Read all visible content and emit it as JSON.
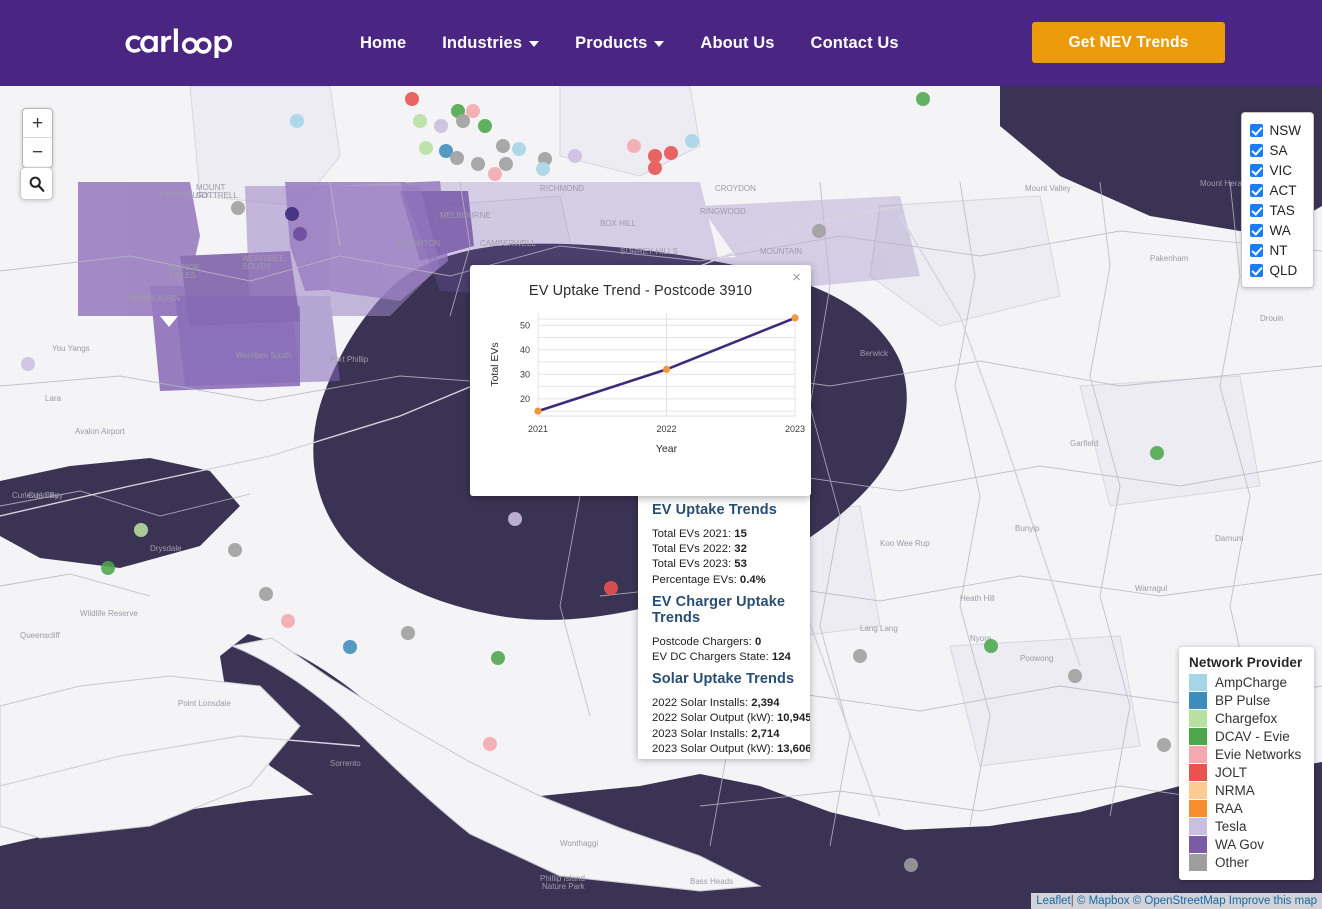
{
  "header": {
    "logo_text": "carloop",
    "nav": [
      {
        "label": "Home",
        "has_dropdown": false
      },
      {
        "label": "Industries",
        "has_dropdown": true
      },
      {
        "label": "Products",
        "has_dropdown": true
      },
      {
        "label": "About Us",
        "has_dropdown": false
      },
      {
        "label": "Contact Us",
        "has_dropdown": false
      }
    ],
    "cta_label": "Get NEV Trends",
    "brand_color": "#4B2582",
    "cta_color": "#EB9B0A"
  },
  "map": {
    "zoom_in_label": "+",
    "zoom_out_label": "−",
    "search_icon": "search-icon",
    "water_color": "#3B3354",
    "land_color": "#F4F3F6",
    "region_highlight_color": "#8C6CB8",
    "attribution": {
      "leaflet": "Leaflet",
      "separator": "|",
      "mapbox": "© Mapbox",
      "osm": "© OpenStreetMap",
      "improve": "Improve this map"
    }
  },
  "state_filter": {
    "items": [
      {
        "label": "NSW",
        "checked": true
      },
      {
        "label": "SA",
        "checked": true
      },
      {
        "label": "VIC",
        "checked": true
      },
      {
        "label": "ACT",
        "checked": true
      },
      {
        "label": "TAS",
        "checked": true
      },
      {
        "label": "WA",
        "checked": true
      },
      {
        "label": "NT",
        "checked": true
      },
      {
        "label": "QLD",
        "checked": true
      }
    ]
  },
  "network_legend": {
    "title": "Network Provider",
    "items": [
      {
        "label": "AmpCharge",
        "color": "#A6D5E8"
      },
      {
        "label": "BP Pulse",
        "color": "#3D8DBC"
      },
      {
        "label": "Chargefox",
        "color": "#B8E0A0"
      },
      {
        "label": "DCAV - Evie",
        "color": "#4CA74C"
      },
      {
        "label": "Evie Networks",
        "color": "#F5A8AE"
      },
      {
        "label": "JOLT",
        "color": "#E8524F"
      },
      {
        "label": "NRMA",
        "color": "#FCCB8F"
      },
      {
        "label": "RAA",
        "color": "#F58E2C"
      },
      {
        "label": "Tesla",
        "color": "#CBBFE0"
      },
      {
        "label": "WA Gov",
        "color": "#7B5AA6"
      },
      {
        "label": "Other",
        "color": "#9E9E9E"
      }
    ]
  },
  "popup": {
    "close_label": "×",
    "title": "EV Uptake Trend - Postcode 3910"
  },
  "chart_data": {
    "type": "line",
    "title": "EV Uptake Trend - Postcode 3910",
    "xlabel": "Year",
    "ylabel": "Total EVs",
    "categories": [
      "2021",
      "2022",
      "2023"
    ],
    "x": [
      2021,
      2022,
      2023
    ],
    "values": [
      15,
      32,
      53
    ],
    "series": [
      {
        "name": "Total EVs",
        "values": [
          15,
          32,
          53
        ],
        "line_color": "#3D2B7A",
        "marker_color": "#F2973B"
      }
    ],
    "ylim": [
      13,
      55
    ],
    "yticks": [
      20,
      30,
      40,
      50
    ],
    "xticks": [
      "2021",
      "2022",
      "2023"
    ],
    "grid": true,
    "legend": "none"
  },
  "info_panel": {
    "sections": [
      {
        "heading": "EV Uptake Trends",
        "rows": [
          {
            "label": "Total EVs 2021: ",
            "value": "15"
          },
          {
            "label": "Total EVs 2022: ",
            "value": "32"
          },
          {
            "label": "Total EVs 2023: ",
            "value": "53"
          },
          {
            "label": "Percentage EVs: ",
            "value": "0.4%"
          }
        ]
      },
      {
        "heading": "EV Charger Uptake Trends",
        "rows": [
          {
            "label": "Postcode Chargers: ",
            "value": "0"
          },
          {
            "label": "EV DC Chargers State: ",
            "value": "124"
          }
        ]
      },
      {
        "heading": "Solar Uptake Trends",
        "rows": [
          {
            "label": "2022 Solar Installs: ",
            "value": "2,394"
          },
          {
            "label": "2022 Solar Output (kW): ",
            "value": "10,945"
          },
          {
            "label": "2023 Solar Installs: ",
            "value": "2,714"
          },
          {
            "label": "2023 Solar Output (kW): ",
            "value": "13,606"
          }
        ]
      }
    ]
  }
}
